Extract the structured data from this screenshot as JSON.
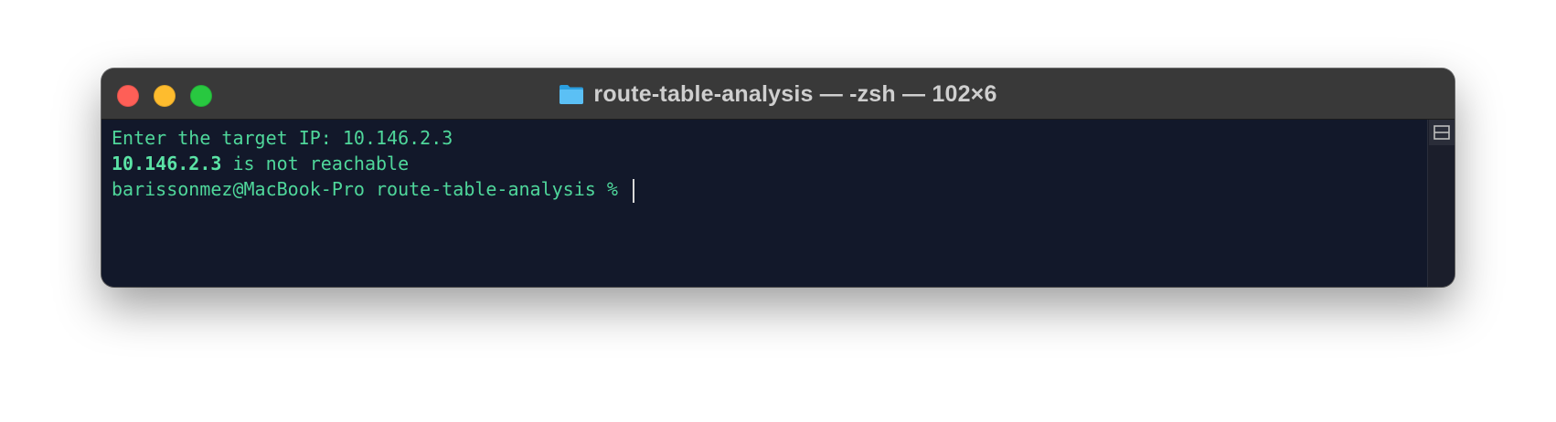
{
  "window": {
    "title": "route-table-analysis — -zsh — 102×6",
    "title_icon": "folder-icon"
  },
  "terminal": {
    "line1": "Enter the target IP: 10.146.2.3",
    "line2_ip": "10.146.2.3",
    "line2_rest": " is not reachable",
    "line3_prompt": "barissonmez@MacBook-Pro route-table-analysis % "
  },
  "colors": {
    "terminal_bg": "#12182a",
    "text_green": "#4fd79b",
    "titlebar": "#393939"
  }
}
